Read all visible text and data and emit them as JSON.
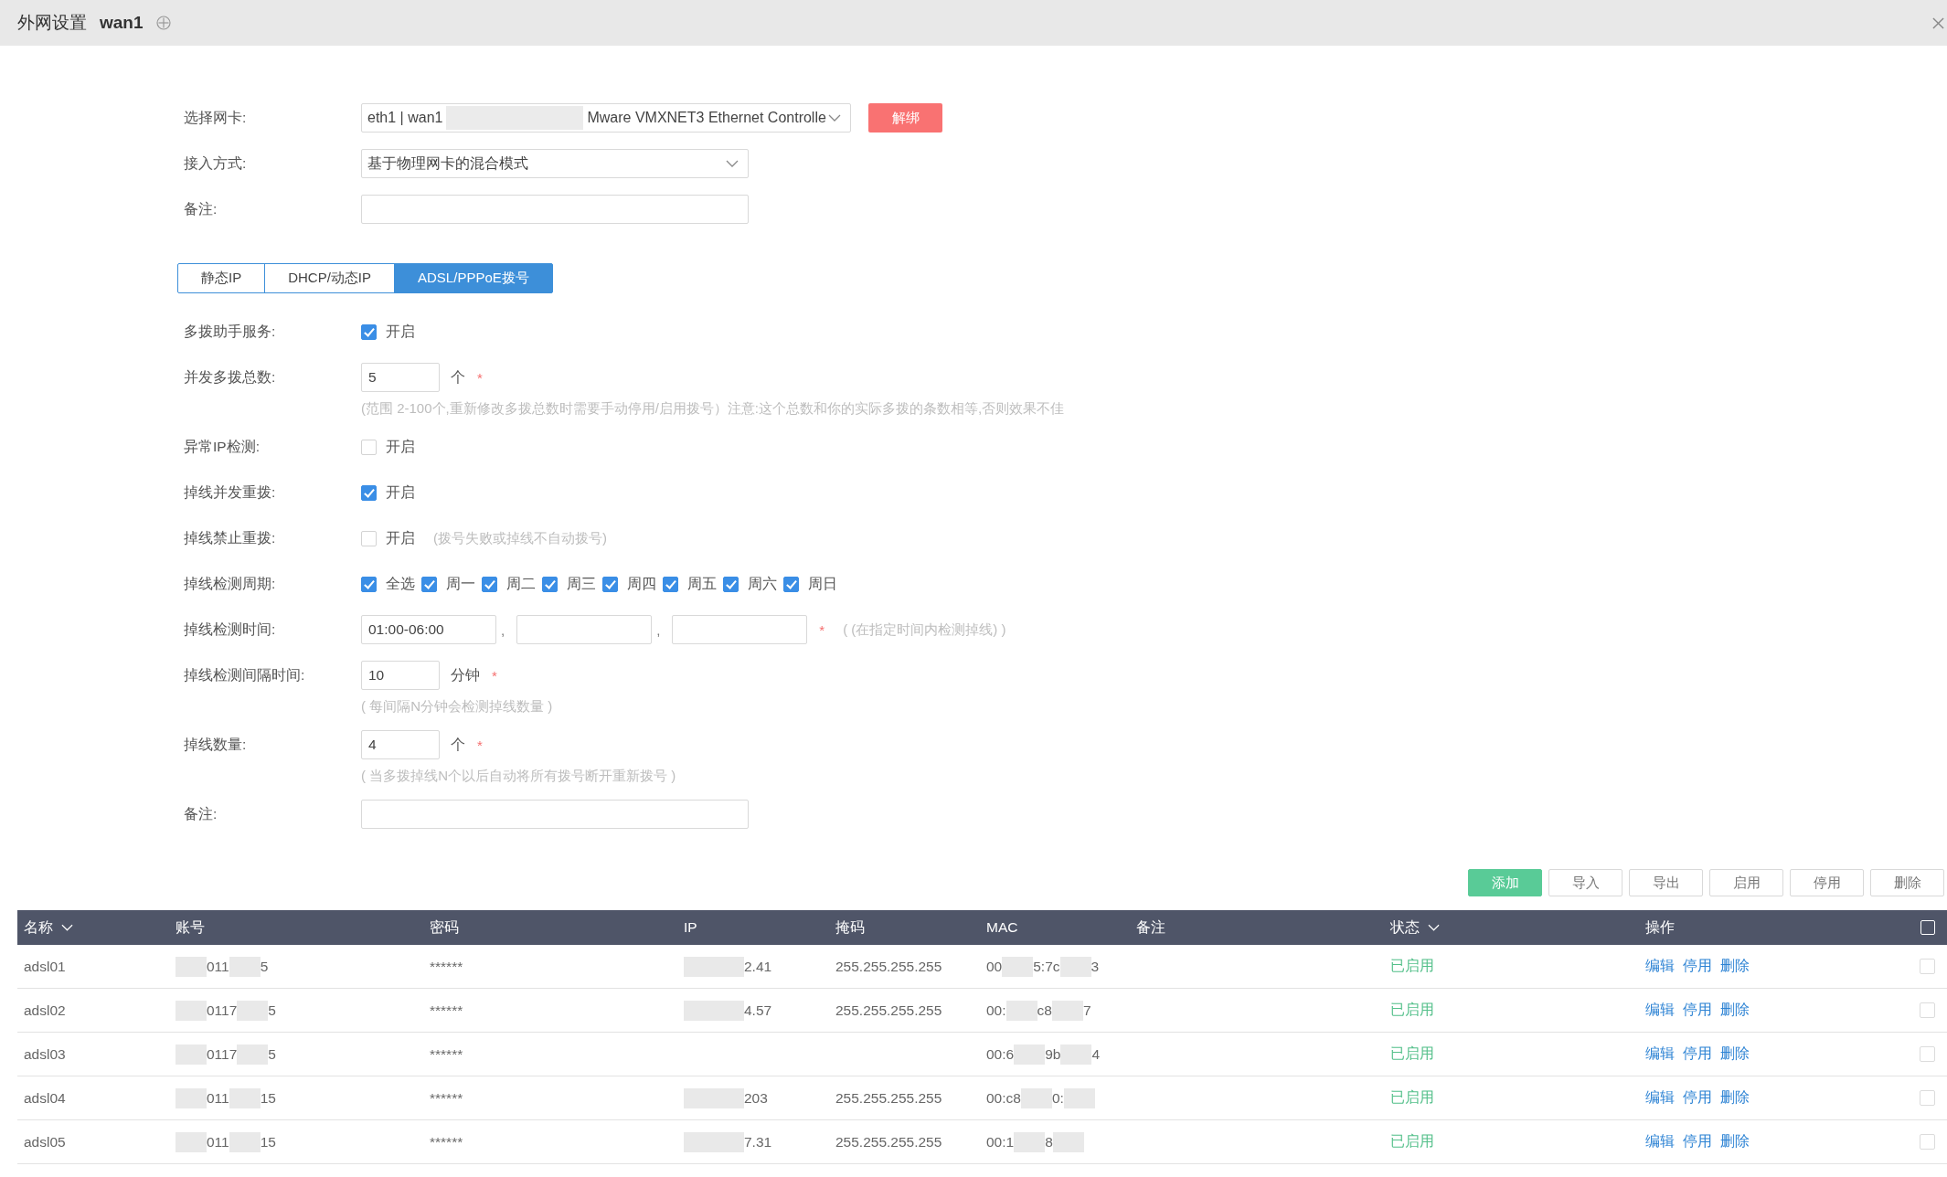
{
  "header": {
    "title": "外网设置",
    "subtitle": "wan1"
  },
  "interface_fields": [
    {
      "kind": "select",
      "label": "选择网卡:",
      "value": [
        {
          "kind": "text",
          "text": "eth1 | wan1"
        },
        {
          "kind": "redacted"
        },
        {
          "kind": "text",
          "text": "Mware VMXNET3 Ethernet Controlle"
        }
      ],
      "action": "解绑"
    },
    {
      "kind": "select",
      "label": "接入方式:",
      "value": [
        {
          "kind": "text",
          "text": "基于物理网卡的混合模式"
        }
      ]
    },
    {
      "kind": "input",
      "label": "备注:"
    }
  ],
  "tabs": [
    {
      "label": "静态IP",
      "selected": false
    },
    {
      "label": "DHCP/动态IP",
      "selected": false
    },
    {
      "label": "ADSL/PPPoE拨号",
      "selected": true
    }
  ],
  "settings": [
    {
      "kind": "toggle",
      "label": "多拨助手服务:",
      "checked": true,
      "option": "开启"
    },
    {
      "kind": "number",
      "label": "并发多拨总数:",
      "value": "5",
      "unit": "个",
      "required_mark": "*",
      "hint": "(范围 2-100个,重新修改多拨总数时需要手动停用/启用拨号）注意:这个总数和你的实际多拨的条数相等,否则效果不佳"
    },
    {
      "kind": "toggle",
      "label": "异常IP检测:",
      "checked": false,
      "option": "开启"
    },
    {
      "kind": "toggle",
      "label": "掉线并发重拨:",
      "checked": true,
      "option": "开启"
    },
    {
      "kind": "toggle",
      "label": "掉线禁止重拨:",
      "checked": false,
      "option": "开启",
      "note": "(拨号失败或掉线不自动拨号)"
    },
    {
      "kind": "checklist",
      "label": "掉线检测周期:",
      "options": [
        {
          "label": "全选",
          "checked": true
        },
        {
          "label": "周一",
          "checked": true
        },
        {
          "label": "周二",
          "checked": true
        },
        {
          "label": "周三",
          "checked": true
        },
        {
          "label": "周四",
          "checked": true
        },
        {
          "label": "周五",
          "checked": true
        },
        {
          "label": "周六",
          "checked": true
        },
        {
          "label": "周日",
          "checked": true
        }
      ]
    },
    {
      "kind": "times",
      "label": "掉线检测时间:",
      "fields": [
        {
          "value": "01:00-06:00"
        },
        {
          "separator": ","
        },
        {
          "separator": ","
        }
      ],
      "required_mark": "*",
      "note": "( (在指定时间内检测掉线) )"
    },
    {
      "kind": "number",
      "label": "掉线检测间隔时间:",
      "value": "10",
      "unit": "分钟",
      "required_mark": "*",
      "hint": "( 每间隔N分钟会检测掉线数量 )"
    },
    {
      "kind": "number",
      "label": "掉线数量:",
      "value": "4",
      "unit": "个",
      "required_mark": "*",
      "hint": "( 当多拨掉线N个以后自动将所有拨号断开重新拨号 )"
    },
    {
      "kind": "input",
      "label": "备注:"
    }
  ],
  "toolbar": [
    {
      "label": "添加",
      "kind": "primary"
    },
    {
      "label": "导入",
      "kind": "plain"
    },
    {
      "label": "导出",
      "kind": "plain"
    },
    {
      "label": "启用",
      "kind": "plain"
    },
    {
      "label": "停用",
      "kind": "plain"
    },
    {
      "label": "删除",
      "kind": "plain"
    }
  ],
  "table": {
    "columns": [
      {
        "label": "名称",
        "sortable": true
      },
      {
        "label": "账号",
        "sortable": false
      },
      {
        "label": "密码",
        "sortable": false
      },
      {
        "label": "IP",
        "sortable": false
      },
      {
        "label": "掩码",
        "sortable": false
      },
      {
        "label": "MAC",
        "sortable": false
      },
      {
        "label": "备注",
        "sortable": false
      },
      {
        "label": "状态",
        "sortable": true
      },
      {
        "label": "操作",
        "sortable": false
      }
    ],
    "select_all": {
      "checked": false
    },
    "rows": [
      {
        "name": "adsl01",
        "account": [
          {
            "kind": "redacted"
          },
          {
            "kind": "text",
            "text": "011"
          },
          {
            "kind": "redacted"
          },
          {
            "kind": "text",
            "text": "5"
          }
        ],
        "password": "******",
        "ip": [
          {
            "kind": "redacted"
          },
          {
            "kind": "text",
            "text": "2.41"
          }
        ],
        "mask": "255.255.255.255",
        "mac": [
          {
            "kind": "text",
            "text": "00"
          },
          {
            "kind": "redacted"
          },
          {
            "kind": "text",
            "text": "5:7c"
          },
          {
            "kind": "redacted"
          },
          {
            "kind": "text",
            "text": "3"
          }
        ],
        "status": "已启用",
        "actions": [
          "编辑",
          "停用",
          "删除"
        ],
        "checked": false
      },
      {
        "name": "adsl02",
        "account": [
          {
            "kind": "redacted"
          },
          {
            "kind": "text",
            "text": "0117"
          },
          {
            "kind": "redacted"
          },
          {
            "kind": "text",
            "text": "5"
          }
        ],
        "password": "******",
        "ip": [
          {
            "kind": "redacted"
          },
          {
            "kind": "text",
            "text": "4.57"
          }
        ],
        "mask": "255.255.255.255",
        "mac": [
          {
            "kind": "text",
            "text": "00:"
          },
          {
            "kind": "redacted"
          },
          {
            "kind": "text",
            "text": "c8"
          },
          {
            "kind": "redacted"
          },
          {
            "kind": "text",
            "text": "7"
          }
        ],
        "status": "已启用",
        "actions": [
          "编辑",
          "停用",
          "删除"
        ],
        "checked": false
      },
      {
        "name": "adsl03",
        "account": [
          {
            "kind": "redacted"
          },
          {
            "kind": "text",
            "text": "0117"
          },
          {
            "kind": "redacted"
          },
          {
            "kind": "text",
            "text": "5"
          }
        ],
        "password": "******",
        "mac": [
          {
            "kind": "text",
            "text": "00:6"
          },
          {
            "kind": "redacted"
          },
          {
            "kind": "text",
            "text": "9b"
          },
          {
            "kind": "redacted"
          },
          {
            "kind": "text",
            "text": "4"
          }
        ],
        "status": "已启用",
        "actions": [
          "编辑",
          "停用",
          "删除"
        ],
        "checked": false
      },
      {
        "name": "adsl04",
        "account": [
          {
            "kind": "redacted"
          },
          {
            "kind": "text",
            "text": "011"
          },
          {
            "kind": "redacted"
          },
          {
            "kind": "text",
            "text": "15"
          }
        ],
        "password": "******",
        "ip": [
          {
            "kind": "redacted"
          },
          {
            "kind": "text",
            "text": "203"
          }
        ],
        "mask": "255.255.255.255",
        "mac": [
          {
            "kind": "text",
            "text": "00:c8"
          },
          {
            "kind": "redacted"
          },
          {
            "kind": "text",
            "text": "0:"
          },
          {
            "kind": "redacted"
          }
        ],
        "status": "已启用",
        "actions": [
          "编辑",
          "停用",
          "删除"
        ],
        "checked": false
      },
      {
        "name": "adsl05",
        "account": [
          {
            "kind": "redacted"
          },
          {
            "kind": "text",
            "text": "011"
          },
          {
            "kind": "redacted"
          },
          {
            "kind": "text",
            "text": "15"
          }
        ],
        "password": "******",
        "ip": [
          {
            "kind": "redacted"
          },
          {
            "kind": "text",
            "text": "7.31"
          }
        ],
        "mask": "255.255.255.255",
        "mac": [
          {
            "kind": "text",
            "text": "00:1"
          },
          {
            "kind": "redacted"
          },
          {
            "kind": "text",
            "text": "8"
          },
          {
            "kind": "redacted"
          }
        ],
        "status": "已启用",
        "actions": [
          "编辑",
          "停用",
          "删除"
        ],
        "checked": false
      }
    ]
  }
}
